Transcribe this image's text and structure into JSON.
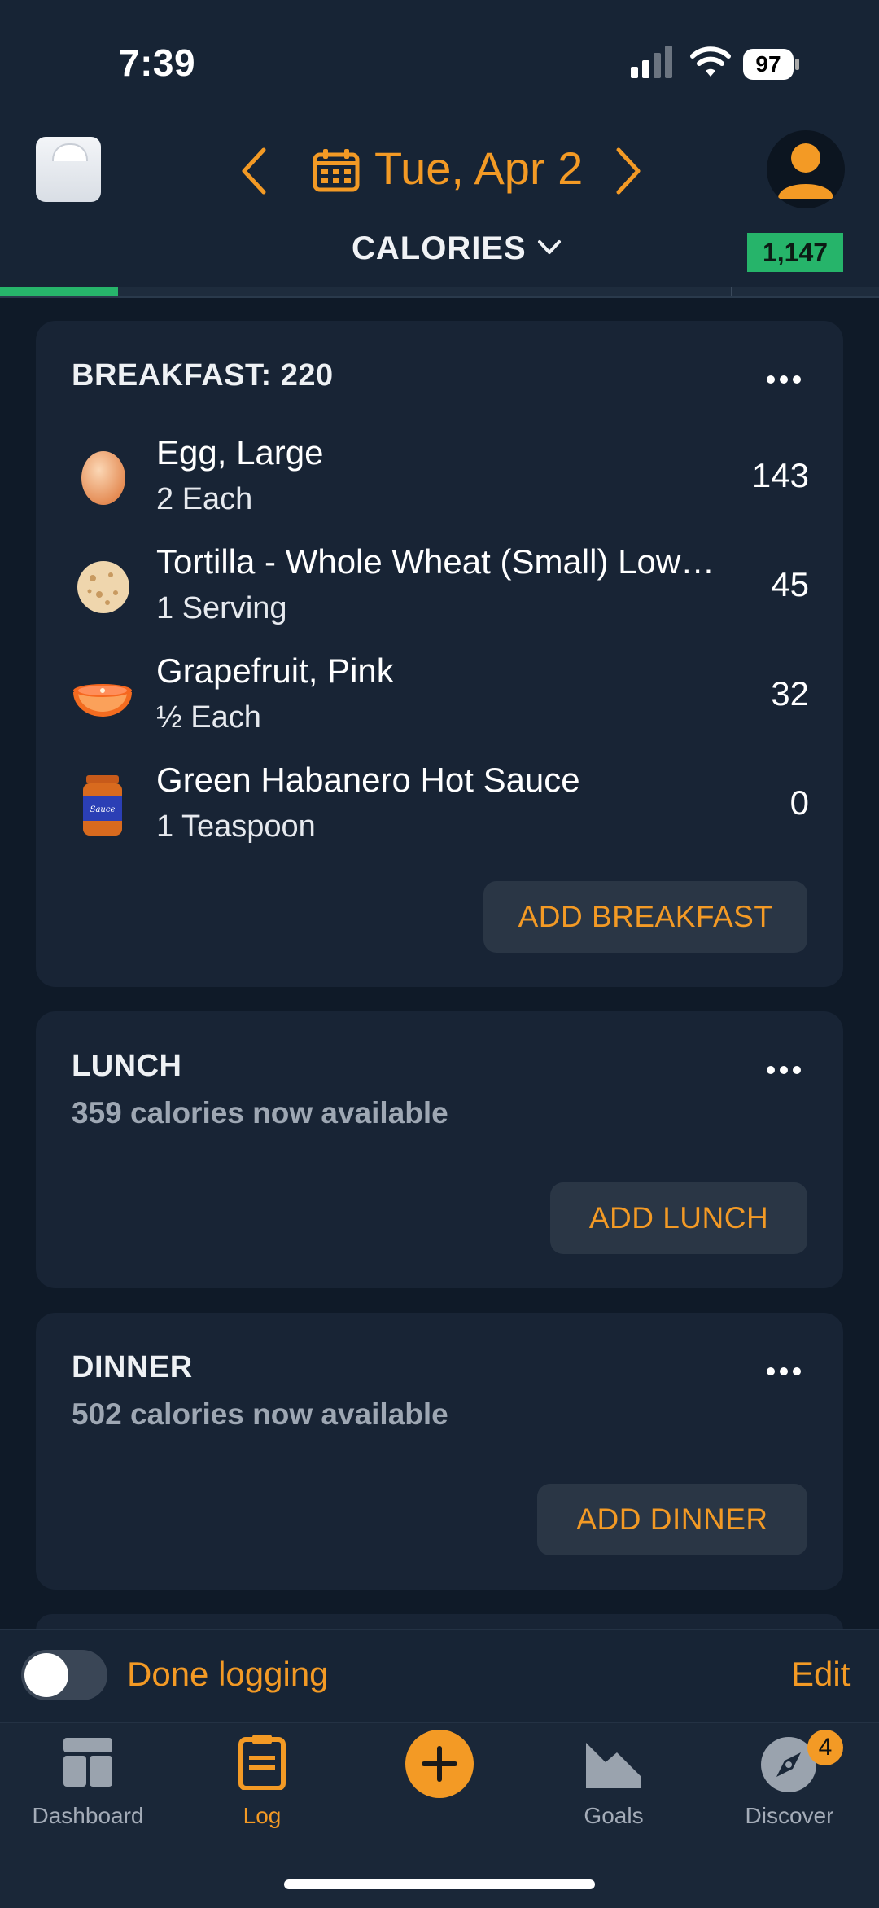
{
  "status_bar": {
    "time": "7:39",
    "battery": "97"
  },
  "header": {
    "date": "Tue, Apr 2",
    "metric": "CALORIES",
    "remaining": "1,147",
    "progress_fraction": 0.134
  },
  "meals": {
    "breakfast": {
      "title": "BREAKFAST: 220",
      "items": [
        {
          "name": "Egg, Large",
          "qty": "2 Each",
          "cal": "143",
          "icon": "egg-icon"
        },
        {
          "name": "Tortilla - Whole Wheat (Small) Low…",
          "qty": "1 Serving",
          "cal": "45",
          "icon": "tortilla-icon"
        },
        {
          "name": "Grapefruit, Pink",
          "qty": "½ Each",
          "cal": "32",
          "icon": "grapefruit-icon"
        },
        {
          "name": "Green Habanero Hot Sauce",
          "qty": "1 Teaspoon",
          "cal": "0",
          "icon": "sauce-jar-icon"
        }
      ],
      "add_label": "ADD BREAKFAST"
    },
    "lunch": {
      "title": "LUNCH",
      "subtitle": "359 calories now available",
      "add_label": "ADD LUNCH"
    },
    "dinner": {
      "title": "DINNER",
      "subtitle": "502 calories now available",
      "add_label": "ADD DINNER"
    }
  },
  "footer": {
    "done_label": "Done logging",
    "edit_label": "Edit",
    "toggle_on": false
  },
  "tabs": {
    "dashboard": "Dashboard",
    "log": "Log",
    "goals": "Goals",
    "discover": "Discover",
    "discover_badge": "4"
  },
  "colors": {
    "accent": "#f39a25",
    "success": "#27b56b",
    "background": "#0f1a28",
    "card": "#182435"
  }
}
